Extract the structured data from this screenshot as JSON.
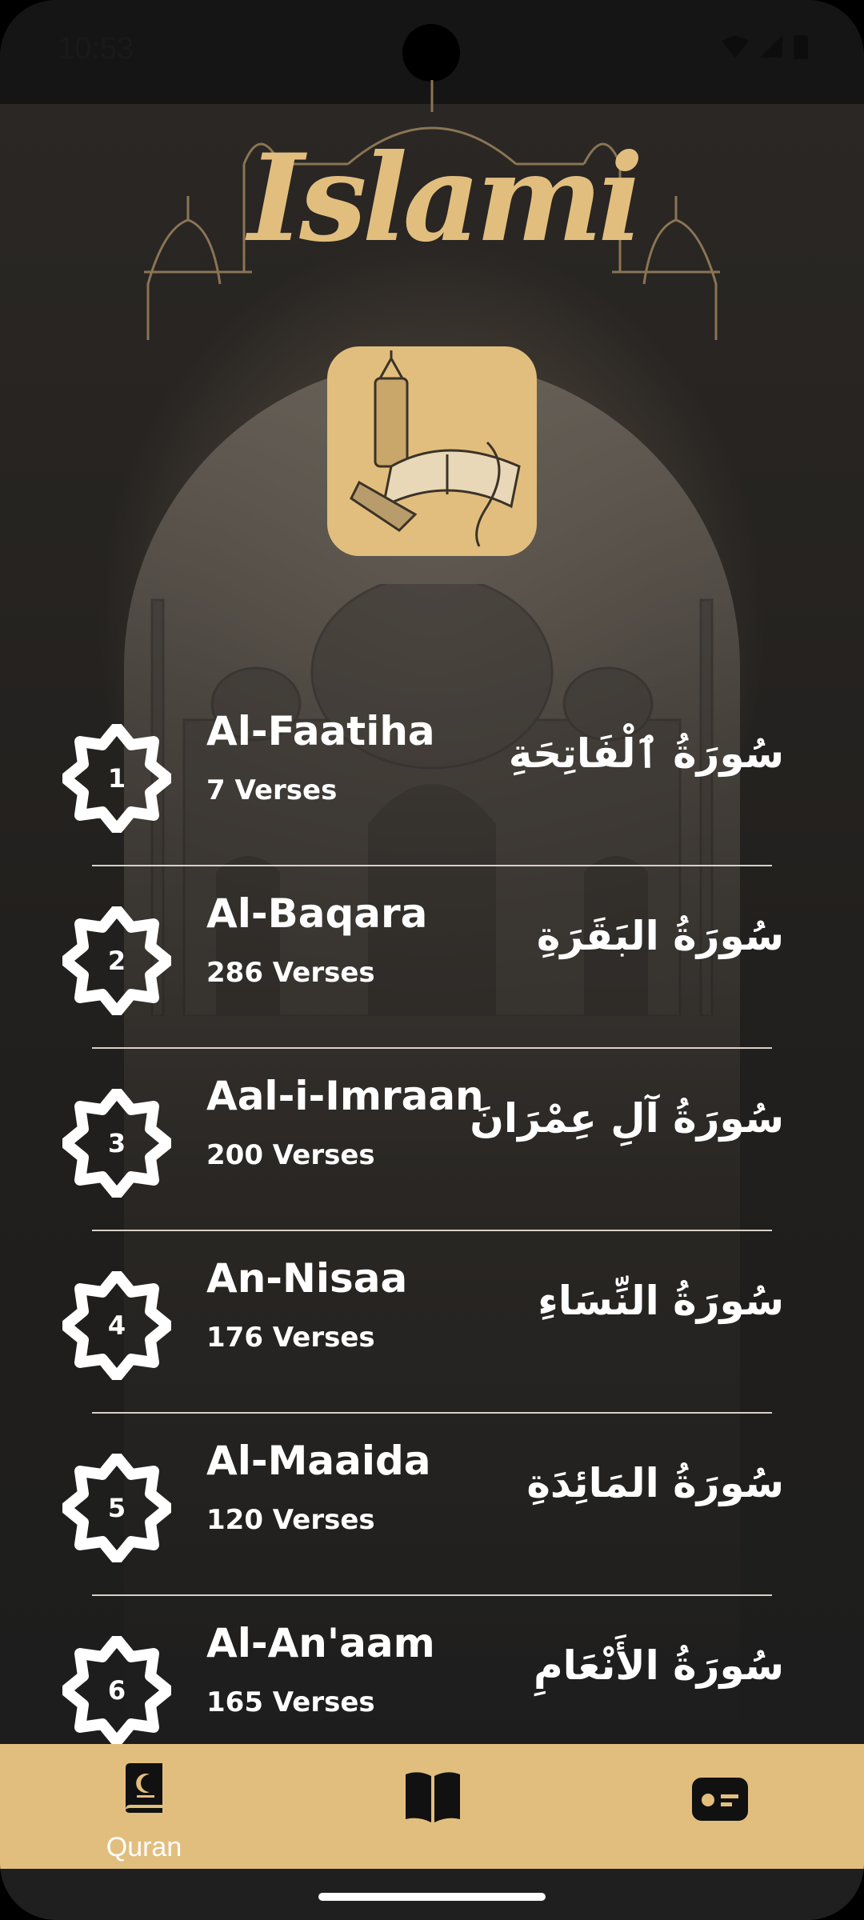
{
  "status_bar": {
    "time": "10:53"
  },
  "header": {
    "logo_text": "Islami"
  },
  "suras": [
    {
      "number": "1",
      "name": "Al-Faatiha",
      "verses": "7 Verses",
      "arabic": "سُورَةُ ٱلْفَاتِحَةِ"
    },
    {
      "number": "2",
      "name": "Al-Baqara",
      "verses": "286 Verses",
      "arabic": "سُورَةُ البَقَرَةِ"
    },
    {
      "number": "3",
      "name": "Aal-i-Imraan",
      "verses": "200 Verses",
      "arabic": "سُورَةُ آلِ عِمْرَانَ"
    },
    {
      "number": "4",
      "name": "An-Nisaa",
      "verses": "176 Verses",
      "arabic": "سُورَةُ النِّسَاءِ"
    },
    {
      "number": "5",
      "name": "Al-Maaida",
      "verses": "120 Verses",
      "arabic": "سُورَةُ المَائِدَةِ"
    },
    {
      "number": "6",
      "name": "Al-An'aam",
      "verses": "165 Verses",
      "arabic": "سُورَةُ الأَنْعَامِ"
    }
  ],
  "bottom_nav": {
    "items": [
      {
        "label": "Quran",
        "icon": "quran-book-icon",
        "selected": true
      },
      {
        "label": "",
        "icon": "open-book-icon",
        "selected": false
      },
      {
        "label": "",
        "icon": "radio-icon",
        "selected": false
      }
    ]
  },
  "colors": {
    "accent": "#E2BE7E",
    "background": "#1F1F1F",
    "text": "#FFFFFF"
  }
}
